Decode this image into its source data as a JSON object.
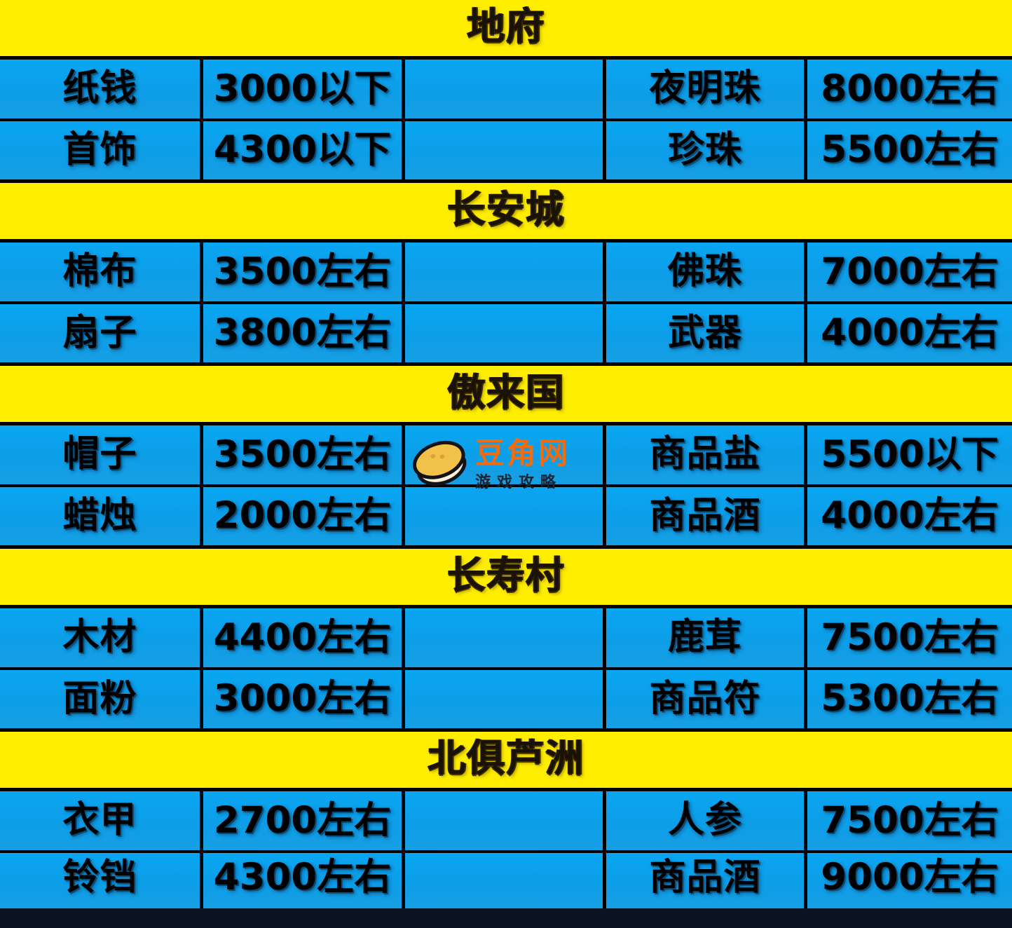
{
  "page": {
    "kind": "price-reference-table",
    "colors": {
      "header_bg": "#ffee00",
      "cell_bg": "#0aa0ee",
      "grid": "#000000",
      "text": "#000000",
      "watermark_brand": "#ef6c10"
    }
  },
  "watermark": {
    "brand": "豆角网",
    "subtitle": "游戏攻略",
    "logo_icon": "bean-logo-icon"
  },
  "sections": [
    {
      "title": "地府",
      "rows": [
        {
          "item": "纸钱",
          "price": "3000以下",
          "gap": "",
          "item2": "夜明珠",
          "price2": "8000左右"
        },
        {
          "item": "首饰",
          "price": "4300以下",
          "gap": "",
          "item2": "珍珠",
          "price2": "5500左右"
        }
      ]
    },
    {
      "title": "长安城",
      "rows": [
        {
          "item": "棉布",
          "price": "3500左右",
          "gap": "",
          "item2": "佛珠",
          "price2": "7000左右"
        },
        {
          "item": "扇子",
          "price": "3800左右",
          "gap": "",
          "item2": "武器",
          "price2": "4000左右"
        }
      ]
    },
    {
      "title": "傲来国",
      "rows": [
        {
          "item": "帽子",
          "price": "3500左右",
          "gap": "",
          "item2": "商品盐",
          "price2": "5500以下"
        },
        {
          "item": "蜡烛",
          "price": "2000左右",
          "gap": "",
          "item2": "商品酒",
          "price2": "4000左右"
        }
      ]
    },
    {
      "title": "长寿村",
      "rows": [
        {
          "item": "木材",
          "price": "4400左右",
          "gap": "",
          "item2": "鹿茸",
          "price2": "7500左右"
        },
        {
          "item": "面粉",
          "price": "3000左右",
          "gap": "",
          "item2": "商品符",
          "price2": "5300左右"
        }
      ]
    },
    {
      "title": "北俱芦洲",
      "rows": [
        {
          "item": "衣甲",
          "price": "2700左右",
          "gap": "",
          "item2": "人参",
          "price2": "7500左右"
        },
        {
          "item": "铃铛",
          "price": "4300左右",
          "gap": "",
          "item2": "商品酒",
          "price2": "9000左右"
        }
      ]
    }
  ]
}
